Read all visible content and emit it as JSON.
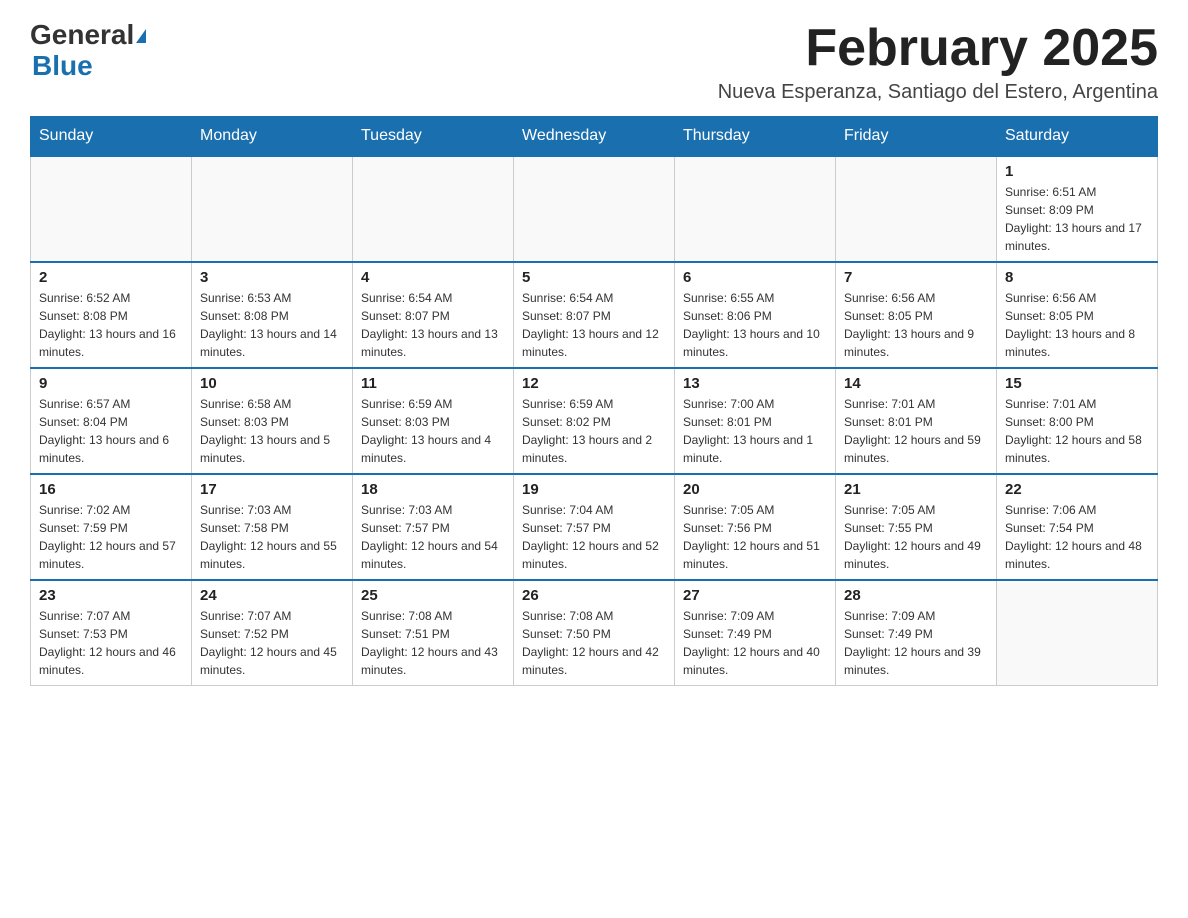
{
  "logo": {
    "general": "General",
    "blue": "Blue",
    "triangle_alt": "triangle decoration"
  },
  "title": "February 2025",
  "subtitle": "Nueva Esperanza, Santiago del Estero, Argentina",
  "weekdays": [
    "Sunday",
    "Monday",
    "Tuesday",
    "Wednesday",
    "Thursday",
    "Friday",
    "Saturday"
  ],
  "weeks": [
    [
      {
        "day": "",
        "info": ""
      },
      {
        "day": "",
        "info": ""
      },
      {
        "day": "",
        "info": ""
      },
      {
        "day": "",
        "info": ""
      },
      {
        "day": "",
        "info": ""
      },
      {
        "day": "",
        "info": ""
      },
      {
        "day": "1",
        "info": "Sunrise: 6:51 AM\nSunset: 8:09 PM\nDaylight: 13 hours and 17 minutes."
      }
    ],
    [
      {
        "day": "2",
        "info": "Sunrise: 6:52 AM\nSunset: 8:08 PM\nDaylight: 13 hours and 16 minutes."
      },
      {
        "day": "3",
        "info": "Sunrise: 6:53 AM\nSunset: 8:08 PM\nDaylight: 13 hours and 14 minutes."
      },
      {
        "day": "4",
        "info": "Sunrise: 6:54 AM\nSunset: 8:07 PM\nDaylight: 13 hours and 13 minutes."
      },
      {
        "day": "5",
        "info": "Sunrise: 6:54 AM\nSunset: 8:07 PM\nDaylight: 13 hours and 12 minutes."
      },
      {
        "day": "6",
        "info": "Sunrise: 6:55 AM\nSunset: 8:06 PM\nDaylight: 13 hours and 10 minutes."
      },
      {
        "day": "7",
        "info": "Sunrise: 6:56 AM\nSunset: 8:05 PM\nDaylight: 13 hours and 9 minutes."
      },
      {
        "day": "8",
        "info": "Sunrise: 6:56 AM\nSunset: 8:05 PM\nDaylight: 13 hours and 8 minutes."
      }
    ],
    [
      {
        "day": "9",
        "info": "Sunrise: 6:57 AM\nSunset: 8:04 PM\nDaylight: 13 hours and 6 minutes."
      },
      {
        "day": "10",
        "info": "Sunrise: 6:58 AM\nSunset: 8:03 PM\nDaylight: 13 hours and 5 minutes."
      },
      {
        "day": "11",
        "info": "Sunrise: 6:59 AM\nSunset: 8:03 PM\nDaylight: 13 hours and 4 minutes."
      },
      {
        "day": "12",
        "info": "Sunrise: 6:59 AM\nSunset: 8:02 PM\nDaylight: 13 hours and 2 minutes."
      },
      {
        "day": "13",
        "info": "Sunrise: 7:00 AM\nSunset: 8:01 PM\nDaylight: 13 hours and 1 minute."
      },
      {
        "day": "14",
        "info": "Sunrise: 7:01 AM\nSunset: 8:01 PM\nDaylight: 12 hours and 59 minutes."
      },
      {
        "day": "15",
        "info": "Sunrise: 7:01 AM\nSunset: 8:00 PM\nDaylight: 12 hours and 58 minutes."
      }
    ],
    [
      {
        "day": "16",
        "info": "Sunrise: 7:02 AM\nSunset: 7:59 PM\nDaylight: 12 hours and 57 minutes."
      },
      {
        "day": "17",
        "info": "Sunrise: 7:03 AM\nSunset: 7:58 PM\nDaylight: 12 hours and 55 minutes."
      },
      {
        "day": "18",
        "info": "Sunrise: 7:03 AM\nSunset: 7:57 PM\nDaylight: 12 hours and 54 minutes."
      },
      {
        "day": "19",
        "info": "Sunrise: 7:04 AM\nSunset: 7:57 PM\nDaylight: 12 hours and 52 minutes."
      },
      {
        "day": "20",
        "info": "Sunrise: 7:05 AM\nSunset: 7:56 PM\nDaylight: 12 hours and 51 minutes."
      },
      {
        "day": "21",
        "info": "Sunrise: 7:05 AM\nSunset: 7:55 PM\nDaylight: 12 hours and 49 minutes."
      },
      {
        "day": "22",
        "info": "Sunrise: 7:06 AM\nSunset: 7:54 PM\nDaylight: 12 hours and 48 minutes."
      }
    ],
    [
      {
        "day": "23",
        "info": "Sunrise: 7:07 AM\nSunset: 7:53 PM\nDaylight: 12 hours and 46 minutes."
      },
      {
        "day": "24",
        "info": "Sunrise: 7:07 AM\nSunset: 7:52 PM\nDaylight: 12 hours and 45 minutes."
      },
      {
        "day": "25",
        "info": "Sunrise: 7:08 AM\nSunset: 7:51 PM\nDaylight: 12 hours and 43 minutes."
      },
      {
        "day": "26",
        "info": "Sunrise: 7:08 AM\nSunset: 7:50 PM\nDaylight: 12 hours and 42 minutes."
      },
      {
        "day": "27",
        "info": "Sunrise: 7:09 AM\nSunset: 7:49 PM\nDaylight: 12 hours and 40 minutes."
      },
      {
        "day": "28",
        "info": "Sunrise: 7:09 AM\nSunset: 7:49 PM\nDaylight: 12 hours and 39 minutes."
      },
      {
        "day": "",
        "info": ""
      }
    ]
  ]
}
